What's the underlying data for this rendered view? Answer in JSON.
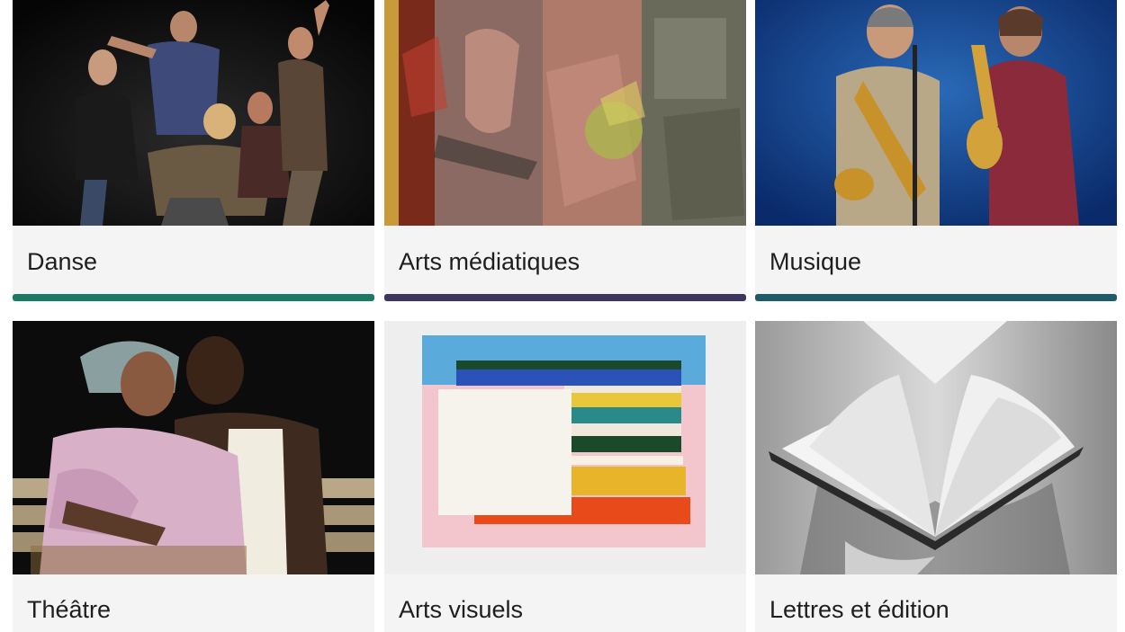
{
  "categories": [
    {
      "label": "Danse",
      "accent": "#1b7a66",
      "image": "dancers-photo"
    },
    {
      "label": "Arts médiatiques",
      "accent": "#3d3560",
      "image": "media-collage-photo"
    },
    {
      "label": "Musique",
      "accent": "#1f5a6a",
      "image": "saxophonists-photo"
    },
    {
      "label": "Théâtre",
      "image": "actors-on-bench-photo"
    },
    {
      "label": "Arts visuels",
      "image": "striped-painting-photo"
    },
    {
      "label": "Lettres et édition",
      "image": "open-book-photo"
    }
  ]
}
